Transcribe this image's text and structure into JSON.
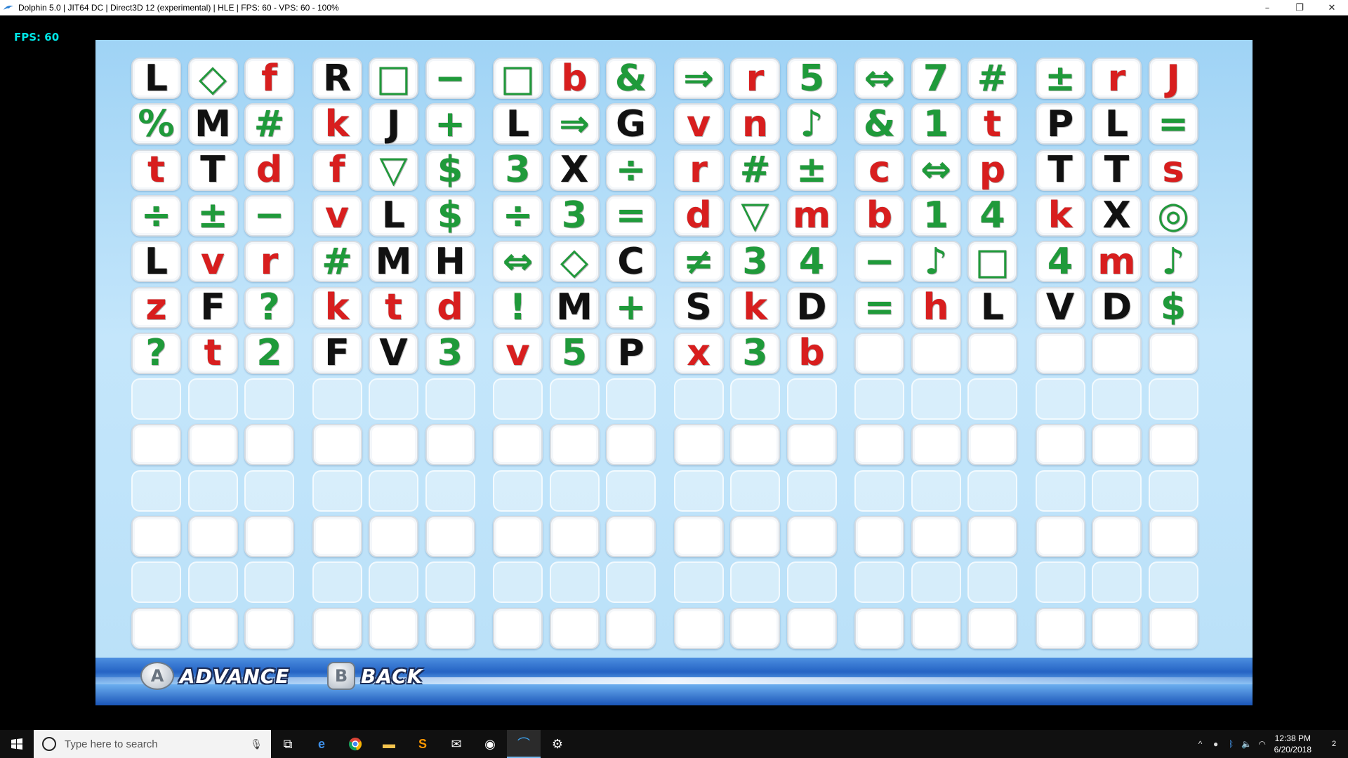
{
  "window": {
    "title": "Dolphin 5.0 | JIT64 DC | Direct3D 12 (experimental) | HLE | FPS: 60 - VPS: 60 - 100%",
    "minimize": "–",
    "restore": "❐",
    "close": "✕"
  },
  "overlay": {
    "fps": "FPS: 60"
  },
  "grid": {
    "rows": [
      [
        [
          "L",
          "k"
        ],
        [
          "◇",
          "g"
        ],
        [
          "f",
          "r"
        ],
        [
          "R",
          "k"
        ],
        [
          "□",
          "g"
        ],
        [
          "−",
          "g"
        ],
        [
          "□",
          "g"
        ],
        [
          "b",
          "r"
        ],
        [
          "&",
          "g"
        ],
        [
          "⇒",
          "g"
        ],
        [
          "r",
          "r"
        ],
        [
          "5",
          "g"
        ],
        [
          "⇔",
          "g"
        ],
        [
          "7",
          "g"
        ],
        [
          "#",
          "g"
        ],
        [
          "±",
          "g"
        ],
        [
          "r",
          "r"
        ],
        [
          "J",
          "r"
        ]
      ],
      [
        [
          "%",
          "g"
        ],
        [
          "M",
          "k"
        ],
        [
          "#",
          "g"
        ],
        [
          "k",
          "r"
        ],
        [
          "J",
          "k"
        ],
        [
          "+",
          "g"
        ],
        [
          "L",
          "k"
        ],
        [
          "⇒",
          "g"
        ],
        [
          "G",
          "k"
        ],
        [
          "v",
          "r"
        ],
        [
          "n",
          "r"
        ],
        [
          "♪",
          "g"
        ],
        [
          "&",
          "g"
        ],
        [
          "1",
          "g"
        ],
        [
          "t",
          "r"
        ],
        [
          "P",
          "k"
        ],
        [
          "L",
          "k"
        ],
        [
          "=",
          "g"
        ]
      ],
      [
        [
          "t",
          "r"
        ],
        [
          "T",
          "k"
        ],
        [
          "d",
          "r"
        ],
        [
          "f",
          "r"
        ],
        [
          "▽",
          "g"
        ],
        [
          "$",
          "g"
        ],
        [
          "3",
          "g"
        ],
        [
          "X",
          "k"
        ],
        [
          "÷",
          "g"
        ],
        [
          "r",
          "r"
        ],
        [
          "#",
          "g"
        ],
        [
          "±",
          "g"
        ],
        [
          "c",
          "r"
        ],
        [
          "⇔",
          "g"
        ],
        [
          "p",
          "r"
        ],
        [
          "T",
          "k"
        ],
        [
          "T",
          "k"
        ],
        [
          "s",
          "r"
        ]
      ],
      [
        [
          "÷",
          "g"
        ],
        [
          "±",
          "g"
        ],
        [
          "−",
          "g"
        ],
        [
          "v",
          "r"
        ],
        [
          "L",
          "k"
        ],
        [
          "$",
          "g"
        ],
        [
          "÷",
          "g"
        ],
        [
          "3",
          "g"
        ],
        [
          "=",
          "g"
        ],
        [
          "d",
          "r"
        ],
        [
          "▽",
          "g"
        ],
        [
          "m",
          "r"
        ],
        [
          "b",
          "r"
        ],
        [
          "1",
          "g"
        ],
        [
          "4",
          "g"
        ],
        [
          "k",
          "r"
        ],
        [
          "X",
          "k"
        ],
        [
          "◎",
          "g"
        ]
      ],
      [
        [
          "L",
          "k"
        ],
        [
          "v",
          "r"
        ],
        [
          "r",
          "r"
        ],
        [
          "#",
          "g"
        ],
        [
          "M",
          "k"
        ],
        [
          "H",
          "k"
        ],
        [
          "⇔",
          "g"
        ],
        [
          "◇",
          "g"
        ],
        [
          "C",
          "k"
        ],
        [
          "≠",
          "g"
        ],
        [
          "3",
          "g"
        ],
        [
          "4",
          "g"
        ],
        [
          "−",
          "g"
        ],
        [
          "♪",
          "g"
        ],
        [
          "□",
          "g"
        ],
        [
          "4",
          "g"
        ],
        [
          "m",
          "r"
        ],
        [
          "♪",
          "g"
        ]
      ],
      [
        [
          "z",
          "r"
        ],
        [
          "F",
          "k"
        ],
        [
          "?",
          "g"
        ],
        [
          "k",
          "r"
        ],
        [
          "t",
          "r"
        ],
        [
          "d",
          "r"
        ],
        [
          "!",
          "g"
        ],
        [
          "M",
          "k"
        ],
        [
          "+",
          "g"
        ],
        [
          "S",
          "k"
        ],
        [
          "k",
          "r"
        ],
        [
          "D",
          "k"
        ],
        [
          "=",
          "g"
        ],
        [
          "h",
          "r"
        ],
        [
          "L",
          "k"
        ],
        [
          "V",
          "k"
        ],
        [
          "D",
          "k"
        ],
        [
          "$",
          "g"
        ]
      ],
      [
        [
          "?",
          "g"
        ],
        [
          "t",
          "r"
        ],
        [
          "2",
          "g"
        ],
        [
          "F",
          "k"
        ],
        [
          "V",
          "k"
        ],
        [
          "3",
          "g"
        ],
        [
          "v",
          "r"
        ],
        [
          "5",
          "g"
        ],
        [
          "P",
          "k"
        ],
        [
          "x",
          "r"
        ],
        [
          "3",
          "g"
        ],
        [
          "b",
          "r"
        ]
      ]
    ],
    "total_rows": 13,
    "columns": 18
  },
  "controls": {
    "a_button": "A",
    "advance_label": "ADVANCE",
    "b_button": "B",
    "back_label": "BACK"
  },
  "taskbar": {
    "search_placeholder": "Type here to search",
    "time": "12:38 PM",
    "date": "6/20/2018",
    "notifications": "2"
  },
  "colors": {
    "black": "#111111",
    "red": "#d81e1e",
    "green": "#1f9a3a",
    "fps": "#00e6e6"
  }
}
